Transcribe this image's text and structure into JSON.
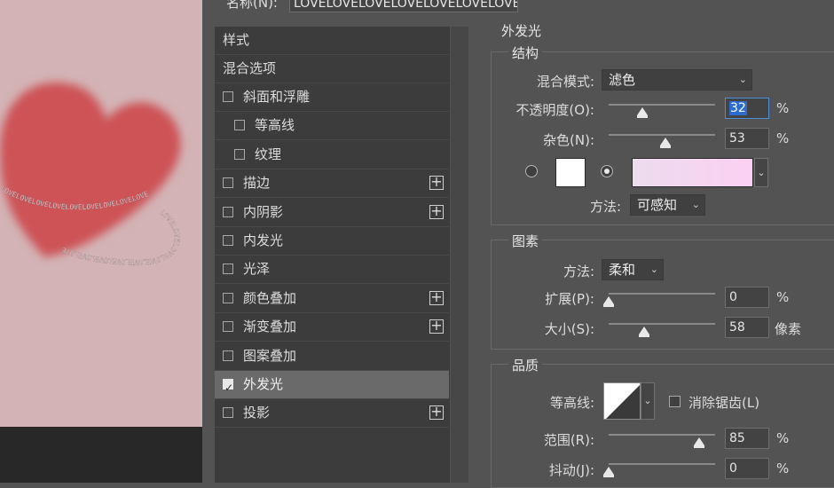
{
  "dialog": {
    "name_label": "名称(N):",
    "name_value": "LOVELOVELOVELOVELOVELOVELOVEL"
  },
  "styles_list": {
    "header_styles": "样式",
    "header_blend": "混合选项",
    "items": [
      {
        "label": "斜面和浮雕",
        "checked": false,
        "plus": false,
        "indent": false
      },
      {
        "label": "等高线",
        "checked": false,
        "plus": false,
        "indent": true
      },
      {
        "label": "纹理",
        "checked": false,
        "plus": false,
        "indent": true
      },
      {
        "label": "描边",
        "checked": false,
        "plus": true,
        "indent": false
      },
      {
        "label": "内阴影",
        "checked": false,
        "plus": true,
        "indent": false
      },
      {
        "label": "内发光",
        "checked": false,
        "plus": false,
        "indent": false
      },
      {
        "label": "光泽",
        "checked": false,
        "plus": false,
        "indent": false
      },
      {
        "label": "颜色叠加",
        "checked": false,
        "plus": true,
        "indent": false
      },
      {
        "label": "渐变叠加",
        "checked": false,
        "plus": true,
        "indent": false
      },
      {
        "label": "图案叠加",
        "checked": false,
        "plus": false,
        "indent": false
      },
      {
        "label": "外发光",
        "checked": true,
        "plus": false,
        "indent": false
      },
      {
        "label": "投影",
        "checked": false,
        "plus": true,
        "indent": false
      }
    ],
    "plus_glyph": "+",
    "tick_glyph": "✓"
  },
  "outer_glow": {
    "title": "外发光",
    "structure": {
      "title": "结构",
      "blend_mode_label": "混合模式:",
      "blend_mode_value": "滤色",
      "opacity_label": "不透明度(O):",
      "opacity_value": "32",
      "opacity_unit": "%",
      "noise_label": "杂色(N):",
      "noise_value": "53",
      "noise_unit": "%",
      "method_label": "方法:",
      "method_value": "可感知",
      "solid_color": "#ffffff",
      "gradient_from": "#ecdcee",
      "gradient_to": "#fcd0f2"
    },
    "elements": {
      "title": "图素",
      "method_label": "方法:",
      "method_value": "柔和",
      "spread_label": "扩展(P):",
      "spread_value": "0",
      "spread_unit": "%",
      "size_label": "大小(S):",
      "size_value": "58",
      "size_unit": "像素"
    },
    "quality": {
      "title": "品质",
      "contour_label": "等高线:",
      "antialias_label": "消除锯齿(L)",
      "range_label": "范围(R):",
      "range_value": "85",
      "range_unit": "%",
      "jitter_label": "抖动(J):",
      "jitter_value": "0",
      "jitter_unit": "%"
    }
  },
  "canvas": {
    "background": "#d3b3b5",
    "heart_color": "#cd5357",
    "ring_text": "LOVELOVELOVELOVELOVELOVELOVELOVELOVE"
  },
  "chevron": "⌄"
}
